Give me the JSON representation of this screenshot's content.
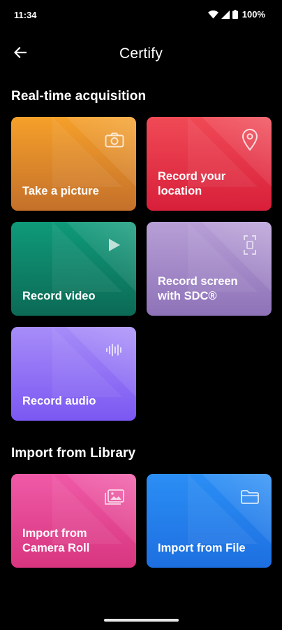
{
  "status": {
    "time": "11:34",
    "battery": "100%"
  },
  "app_bar": {
    "title": "Certify",
    "back_icon": "arrow-left-icon"
  },
  "sections": {
    "realtime": {
      "title": "Real-time acquisition",
      "cards": [
        {
          "label": "Take a picture",
          "icon": "camera-icon",
          "colors": [
            "#f5a02a",
            "#c4702a"
          ]
        },
        {
          "label": "Record your\nlocation",
          "icon": "location-pin-icon",
          "colors": [
            "#f04a56",
            "#d81f3a"
          ]
        },
        {
          "label": "Record video",
          "icon": "play-icon",
          "colors": [
            "#0f9a7a",
            "#0c6a55"
          ]
        },
        {
          "label": "Record screen\nwith SDC®",
          "icon": "screen-record-icon",
          "colors": [
            "#b79fd6",
            "#8e72b8"
          ]
        },
        {
          "label": "Record audio",
          "icon": "waveform-icon",
          "colors": [
            "#a68cf8",
            "#7b58f2"
          ]
        }
      ]
    },
    "library": {
      "title": "Import from Library",
      "cards": [
        {
          "label": "Import from\nCamera Roll",
          "icon": "image-icon",
          "colors": [
            "#ef5aa7",
            "#d8357f"
          ]
        },
        {
          "label": "Import from File",
          "icon": "folder-icon",
          "colors": [
            "#2b8ef5",
            "#1d6fe0"
          ]
        }
      ]
    }
  }
}
